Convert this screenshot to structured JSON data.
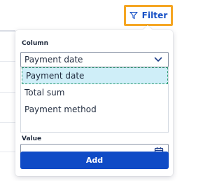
{
  "filter_button": {
    "label": "Filter",
    "icon": "filter-icon",
    "highlight_color": "#f5a623"
  },
  "panel": {
    "column_label": "Column",
    "column_select": {
      "selected": "Payment date",
      "icon": "chevron-down-icon"
    },
    "column_options": [
      {
        "label": "Payment date",
        "selected": true
      },
      {
        "label": "Total sum",
        "selected": false
      },
      {
        "label": "Payment method",
        "selected": false
      }
    ],
    "value_label": "Value",
    "value_input": {
      "value": "",
      "icon": "calendar-icon"
    },
    "add_button": {
      "label": "Add"
    }
  },
  "colors": {
    "accent": "#0f4bc6",
    "selected_option_bg": "#cfeef8"
  }
}
